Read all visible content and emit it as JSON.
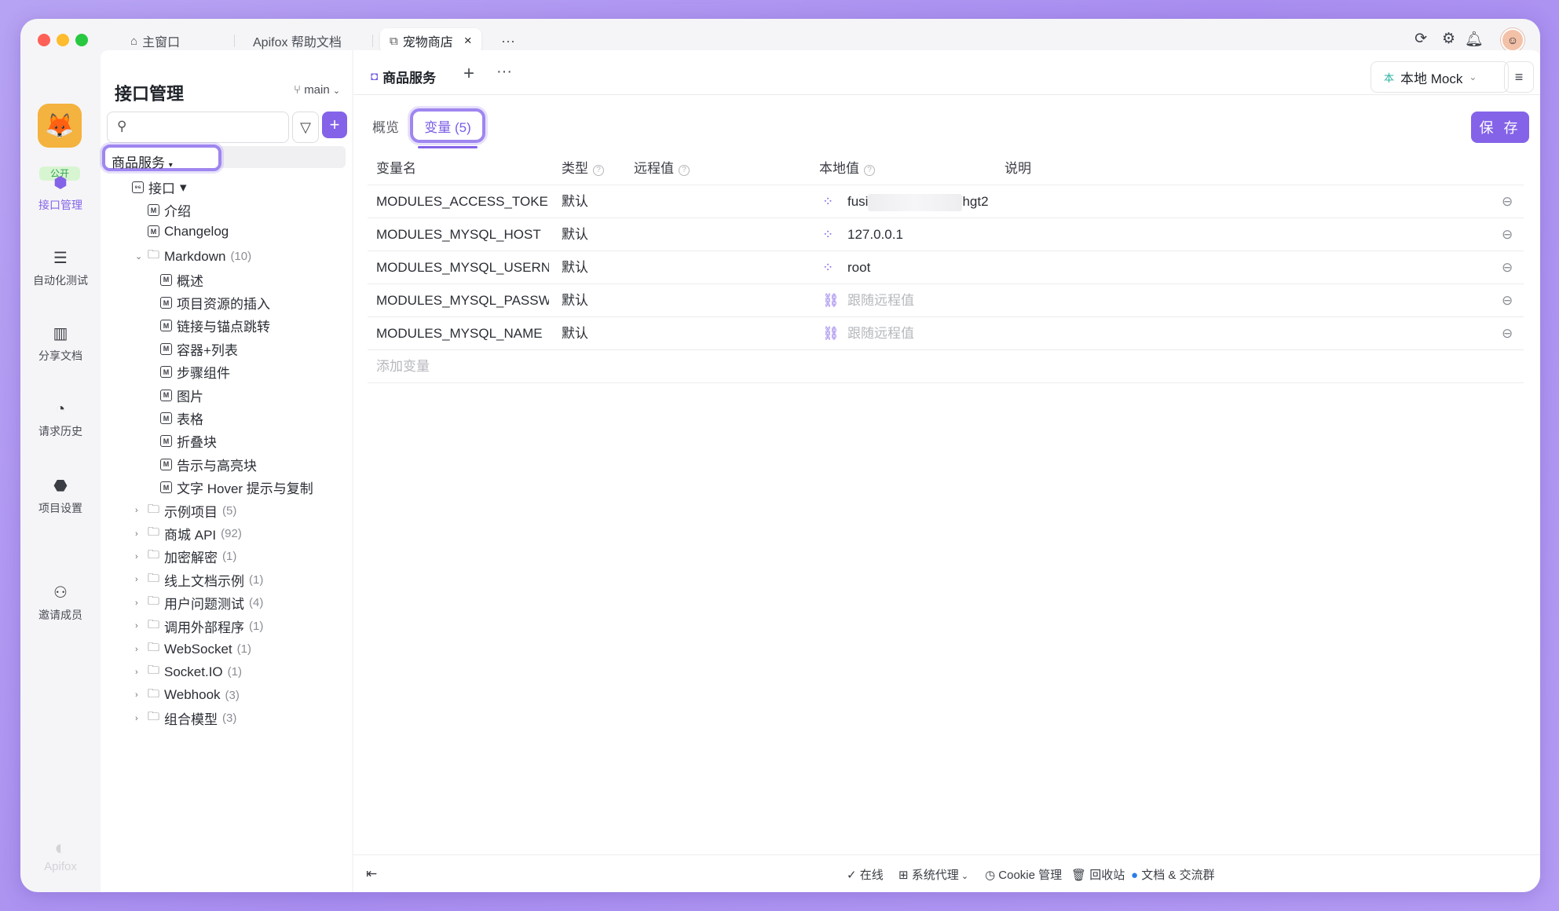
{
  "window_tabs": [
    {
      "label": "主窗口",
      "icon": "home-icon"
    },
    {
      "label": "Apifox 帮助文档",
      "icon": ""
    },
    {
      "label": "宠物商店",
      "icon": "external-link-icon",
      "close": "×"
    }
  ],
  "window_tabs_more": "···",
  "rail": {
    "public_badge": "公开",
    "items": [
      {
        "label": "接口管理",
        "icon": "api-icon",
        "active": true
      },
      {
        "label": "自动化测试",
        "icon": "automation-icon"
      },
      {
        "label": "分享文档",
        "icon": "book-icon"
      },
      {
        "label": "请求历史",
        "icon": "clock-icon"
      },
      {
        "label": "项目设置",
        "icon": "settings-icon"
      },
      {
        "label": "邀请成员",
        "icon": "add-user-icon"
      }
    ],
    "footer_logo": "Apifox"
  },
  "sidebar": {
    "title": "接口管理",
    "branch": "main",
    "selected": "商品服务",
    "tree": [
      {
        "label": "接口",
        "kind": "api-root"
      },
      {
        "label": "介绍",
        "kind": "md"
      },
      {
        "label": "Changelog",
        "kind": "md"
      },
      {
        "label": "Markdown",
        "kind": "folder-open",
        "count": "(10)"
      },
      {
        "label": "概述",
        "kind": "md2"
      },
      {
        "label": "项目资源的插入",
        "kind": "md2"
      },
      {
        "label": "链接与锚点跳转",
        "kind": "md2"
      },
      {
        "label": "容器+列表",
        "kind": "md2"
      },
      {
        "label": "步骤组件",
        "kind": "md2"
      },
      {
        "label": "图片",
        "kind": "md2"
      },
      {
        "label": "表格",
        "kind": "md2"
      },
      {
        "label": "折叠块",
        "kind": "md2"
      },
      {
        "label": "告示与高亮块",
        "kind": "md2"
      },
      {
        "label": "文字 Hover 提示与复制",
        "kind": "md2"
      },
      {
        "label": "示例项目",
        "kind": "folder",
        "count": "(5)"
      },
      {
        "label": "商城 API",
        "kind": "folder",
        "count": "(92)"
      },
      {
        "label": "加密解密",
        "kind": "folder",
        "count": "(1)"
      },
      {
        "label": "线上文档示例",
        "kind": "folder",
        "count": "(1)"
      },
      {
        "label": "用户问题测试",
        "kind": "folder",
        "count": "(4)"
      },
      {
        "label": "调用外部程序",
        "kind": "folder",
        "count": "(1)"
      },
      {
        "label": "WebSocket",
        "kind": "folder",
        "count": "(1)"
      },
      {
        "label": "Socket.IO",
        "kind": "folder",
        "count": "(1)"
      },
      {
        "label": "Webhook",
        "kind": "folder",
        "count": "(3)"
      },
      {
        "label": "组合模型",
        "kind": "folder",
        "count": "(3)"
      }
    ]
  },
  "main": {
    "tab_label": "商品服务",
    "env_badge": "本",
    "env_label": "本地 Mock",
    "sub_tabs": {
      "overview": "概览",
      "variables": "变量 (5)"
    },
    "save_label": "保 存",
    "table": {
      "headers": {
        "name": "变量名",
        "type": "类型",
        "remote": "远程值",
        "local": "本地值",
        "desc": "说明"
      },
      "rows": [
        {
          "name": "MODULES_ACCESS_TOKEN",
          "type": "默认",
          "local_prefix": "fusi",
          "local_suffix": "hgt2",
          "local_icon": "unlinked-icon"
        },
        {
          "name": "MODULES_MYSQL_HOST",
          "type": "默认",
          "local": "127.0.0.1",
          "local_icon": "unlinked-icon"
        },
        {
          "name": "MODULES_MYSQL_USERNAME",
          "type": "默认",
          "local": "root",
          "local_icon": "unlinked-icon"
        },
        {
          "name": "MODULES_MYSQL_PASSWORD",
          "type": "默认",
          "local_placeholder": "跟随远程值",
          "local_icon": "link-icon"
        },
        {
          "name": "MODULES_MYSQL_NAME",
          "type": "默认",
          "local_placeholder": "跟随远程值",
          "local_icon": "link-icon"
        }
      ],
      "add_placeholder": "添加变量"
    }
  },
  "footer": {
    "online": "在线",
    "proxy": "系统代理",
    "cookie": "Cookie 管理",
    "trash": "回收站",
    "community": "文档 & 交流群"
  },
  "colors": {
    "accent": "#8463e8",
    "window_bg": "#f5f5f7",
    "frame": "#b49cf4"
  }
}
